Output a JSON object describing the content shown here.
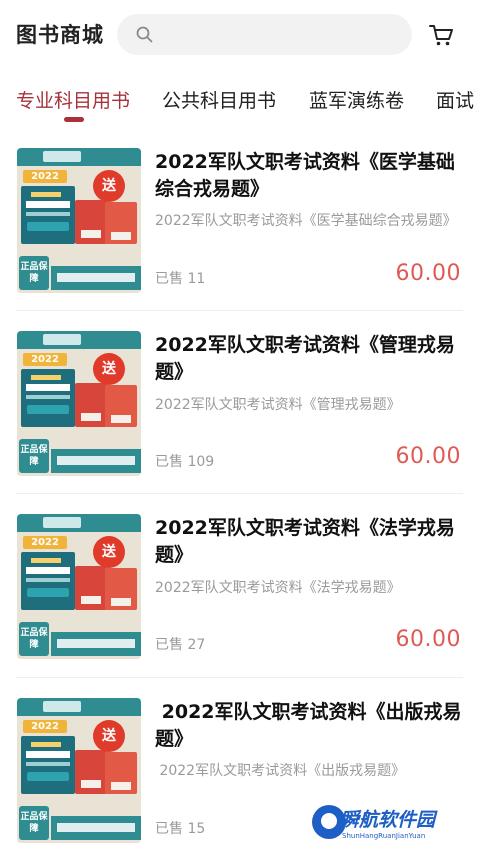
{
  "header": {
    "title": "图书商城",
    "search_placeholder": ""
  },
  "tabs": [
    {
      "label": "专业科目用书",
      "active": true
    },
    {
      "label": "公共科目用书",
      "active": false
    },
    {
      "label": "蓝军演练卷",
      "active": false
    },
    {
      "label": "面试",
      "active": false
    }
  ],
  "products": [
    {
      "name": "2022军队文职考试资料《医学基础综合戎易题》",
      "description": "2022军队文职考试资料《医学基础综合戎易题》",
      "sold": "已售 11",
      "price": "60.00"
    },
    {
      "name": "2022军队文职考试资料《管理戎易题》",
      "description": "2022军队文职考试资料《管理戎易题》",
      "sold": "已售 109",
      "price": "60.00"
    },
    {
      "name": "2022军队文职考试资料《法学戎易题》",
      "description": "2022军队文职考试资料《法学戎易题》",
      "sold": "已售 27",
      "price": "60.00"
    },
    {
      "name": " 2022军队文职考试资料《出版戎易题》",
      "description": " 2022军队文职考试资料《出版戎易题》",
      "sold": "已售 15",
      "price": ""
    }
  ],
  "cover": {
    "year": "2022",
    "badge": "送",
    "seal_text": "正品保障",
    "buy_text": "购买",
    "course_text": "大纲解读课程",
    "bundle_text": "习题集+解析",
    "band_text": "军队文职人员考试"
  },
  "watermark": {
    "cn": "瞬航软件园",
    "en": "ShunHangRuanJianYuan"
  },
  "colors": {
    "accent": "#a8313b",
    "price": "#e05a55",
    "muted": "#9a9a9a",
    "brand_teal": "#2f8d92"
  },
  "icons": {
    "search": "search-icon",
    "cart": "cart-icon"
  }
}
